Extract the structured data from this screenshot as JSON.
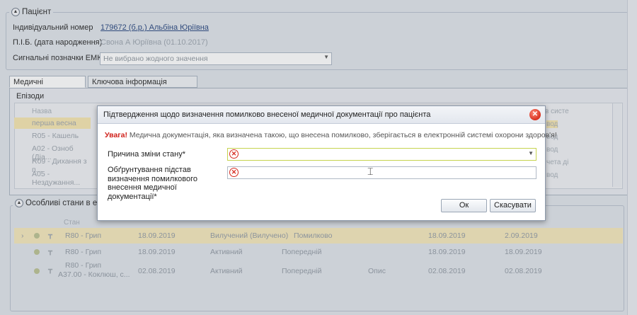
{
  "patient": {
    "legend": "Пацієнт",
    "id_label": "Індивідуальний номер",
    "id_value": "179672 (б.р.) Альбіна Юріївна",
    "name_label": "П.І.Б. (дата народження)",
    "name_value": "Свона А Юріївна (01.10.2017)",
    "signals_label": "Сигнальні позначки ЕМК",
    "signals_placeholder": "Не вибрано жодного значення"
  },
  "tabs": [
    "Медичні документи",
    "Ключова інформація пацієнта"
  ],
  "episodes": {
    "legend": "Епізоди",
    "col_name": "Назва",
    "col_right": "в систе",
    "rows": [
      "перша весна",
      "R05 - Кашель",
      "A02 - Озноб (Діа...",
      "R09 - Дихання з п...",
      "A05 - Нездужання..."
    ],
    "right_rows": [
      "вод",
      "вод",
      "вод",
      "чета ді",
      "вод"
    ]
  },
  "conditions": {
    "legend": "Особливі стани в eHea",
    "col_state": "Стан",
    "rows": [
      {
        "code": "R80 - Грип",
        "date": "18.09.2019",
        "status": "Вилучений (Вилучено)",
        "verif": "Помилково",
        "onset": "18.09.2019",
        "recorded": "2.09.2019"
      },
      {
        "code": "R80 - Грип",
        "date": "18.09.2019",
        "status": "Активний",
        "verif": "Попередній",
        "onset": "18.09.2019",
        "recorded": "18.09.2019"
      },
      {
        "code": "R80 - Грип",
        "code2": "A37.00 - Коклюш, с...",
        "date": "02.08.2019",
        "status": "Активний",
        "verif": "Попередній",
        "extra": "Опис",
        "onset": "02.08.2019",
        "recorded": "02.08.2019"
      }
    ]
  },
  "dialog": {
    "title": "Підтвердження щодо визначення помилково внесеної медичної документації про пацієнта",
    "warning_bold": "Увага!",
    "warning_text": " Медична документація, яка визначена такою, що внесена помилково, зберігається в електронній системі охорони здоров'я!",
    "reason_label": "Причина зміни стану*",
    "justification_label": "Обґрунтування підстав визначення помилкового внесення медичної документації*",
    "ok_label": "Ок",
    "cancel_label": "Скасувати",
    "close_icon": "close-icon",
    "error_icon": "error-icon"
  },
  "colors": {
    "warning": "#d0201a",
    "error": "#d62b1f",
    "selected_row": "#f4e7b9"
  }
}
